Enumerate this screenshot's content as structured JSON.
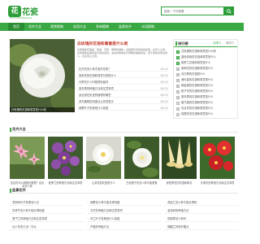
{
  "brand": {
    "logo_mark": "花",
    "logo_text": "花瓷",
    "tagline": "HUAYUANQIAO",
    "color": "#2d9e3a",
    "nav_color": "#3aa843"
  },
  "search": {
    "placeholder": "搜索一下你想要"
  },
  "nav": {
    "items": [
      "首页",
      "花卉大全",
      "观赏植物",
      "花语大全",
      "多肉植物",
      "盆栽花卉",
      "水培植物"
    ],
    "active_index": 0
  },
  "feature": {
    "caption": "白玫瑰的花语和寓意是什么呢",
    "title": "白玫瑰的花语和寓意是什么呢",
    "summary": "白玫瑰的花语是：纯洁、天真、尊敬和谦卑。白玫瑰代表纯洁的爱情，在恋人之间，白玫瑰象征着纯洁天真的爱情。洁白的玫瑰表示尊敬和谦卑的爱，用于送给你所爱的人，表达真心之意。",
    "list": [
      {
        "title": "牡丹花怎么养才能开花呢？",
        "date": "08-25"
      },
      {
        "title": "茉莉花的花语和寓意分别是什么",
        "date": "08-25"
      },
      {
        "title": "月季花什么时候修剪最好",
        "date": "08-25"
      },
      {
        "title": "薰衣草的种植方法和注意事项",
        "date": "08-25"
      },
      {
        "title": "适合放在卧室的植物有哪些",
        "date": "08-25"
      },
      {
        "title": "多肉植物如何度过炎热的夏天",
        "date": "08-25"
      },
      {
        "title": "绿萝叶子发黄是什么原因",
        "date": "08-25"
      }
    ]
  },
  "sidebar": {
    "title": "排行榜",
    "tab_active": "月排行",
    "tab_other": "周排行",
    "items": [
      "白玫瑰的花语和寓意是什么呢",
      "蓝色妖姬的花语和寓意是什么",
      "紫罗兰花语和寓意是什么",
      "茉莉花的花语和寓意是什么",
      "向日葵的花语是什么",
      "满天星的花语和寓意是什么",
      "郁金香的花语和寓意是什么",
      "栀子花的花语和寓意是什么",
      "薰衣草的花语和寓意是什么",
      "康乃馨的花语和寓意是什么",
      "百合花的花语和寓意是什么",
      "桔梗花的花语和寓意是什么"
    ]
  },
  "flowers": {
    "title": "花卉大全",
    "cards": [
      "百合花可以种植在哪里？百合花怎么养",
      "紫罗兰的养殖方法和注意事项",
      "山茶花的花语是什么",
      "白色栀子花怎么养才能更香",
      "曼陀罗花的花语和寓意",
      "长寿花的养殖方法和注意事项"
    ]
  },
  "plants": {
    "title": "盆景花卉",
    "cols": [
      [
        "发财树叶子发黄怎么办",
        "富贵竹怎么养才能长得旺盛",
        "君子兰的养殖方法和注意事项",
        "仙人掌多久浇一次水"
      ],
      [
        "绿萝怎么养才能长得茂盛",
        "文竹的养殖方法和注意事项",
        "吊兰叶子发黄是什么原因",
        "芦荟的养殖方法"
      ],
      [
        "虎皮兰怎么养才能长得旺",
        "金钱树的养殖方法",
        "铜钱草怎么养好",
        "蝴蝶兰的养护要点"
      ]
    ]
  }
}
